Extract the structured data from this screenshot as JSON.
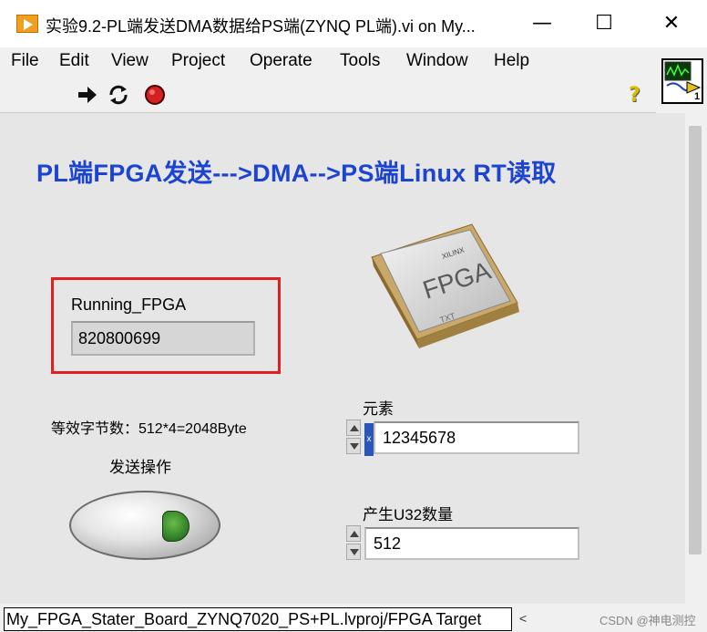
{
  "window": {
    "title": "实验9.2-PL端发送DMA数据给PS端(ZYNQ PL端).vi on My...",
    "minimize": "—",
    "maximize": "☐",
    "close": "✕"
  },
  "menu": [
    "File",
    "Edit",
    "View",
    "Project",
    "Operate",
    "Tools",
    "Window",
    "Help"
  ],
  "toolbar": {
    "icons": [
      "run-arrow-icon",
      "run-continuously-icon",
      "abort-stop-icon"
    ],
    "help_glyph": "?"
  },
  "panel": {
    "heading": "PL端FPGA发送--->DMA-->PS端Linux RT读取",
    "running_label": "Running_FPGA",
    "running_value": "820800699",
    "info_text": "等效字节数：512*4=2048Byte",
    "send_button_label": "发送操作",
    "chip_brand": "XILINX",
    "chip_text": "FPGA",
    "chip_sub": "TXT",
    "element_label": "元素",
    "element_value": "12345678",
    "radix_glyph": "x",
    "count_label": "产生U32数量",
    "count_value": "512"
  },
  "vi_icon": {
    "connector_number": "1"
  },
  "status": {
    "path": "My_FPGA_Stater_Board_ZYNQ7020_PS+PL.lvproj/FPGA Target",
    "scroll_left": "<",
    "watermark": "CSDN @神电测控"
  },
  "colors": {
    "heading": "#1d44d0",
    "highlight_box": "#e02020",
    "led_green": "#2c7a24"
  }
}
